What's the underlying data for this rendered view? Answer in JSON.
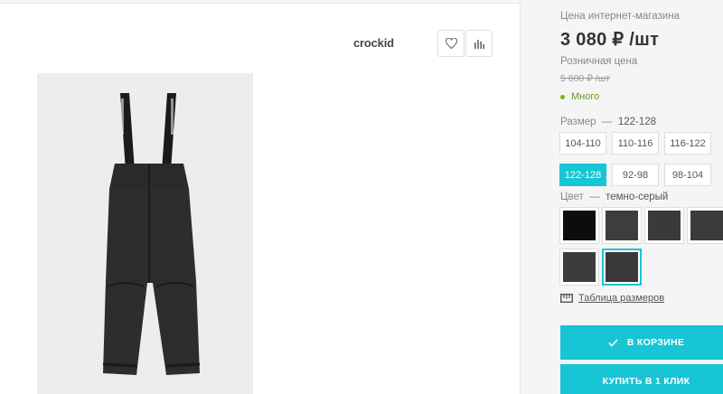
{
  "brand": {
    "name": "crockid"
  },
  "toolbar": {
    "favorite_icon": "heart-icon",
    "compare_icon": "bar-chart-icon"
  },
  "product": {
    "image_alt": "crockid"
  },
  "pricing": {
    "online_label": "Цена интернет-магазина",
    "online_price": "3 080 ₽ /шт",
    "retail_label": "Розничная цена",
    "retail_price": "5 600 ₽ /шт"
  },
  "stock": {
    "label": "Много",
    "color": "#7ab317"
  },
  "size": {
    "label": "Размер",
    "selected": "122-128",
    "options": [
      "104-110",
      "110-116",
      "116-122",
      "122-128",
      "92-98",
      "98-104"
    ]
  },
  "color": {
    "label": "Цвет",
    "selected": "темно-серый",
    "swatches": [
      "#0d0d0d",
      "#3d3d3f",
      "#3a3a3c",
      "#3b3b3d",
      "#3c3c3e",
      "#39393b"
    ]
  },
  "size_table": {
    "label": "Таблица размеров",
    "icon": "ruler-icon"
  },
  "actions": {
    "cart_label": "В КОРЗИНЕ",
    "cart_icon": "check-icon",
    "one_click_label": "КУПИТЬ В 1 КЛИК"
  },
  "accent": "#16c6d4"
}
